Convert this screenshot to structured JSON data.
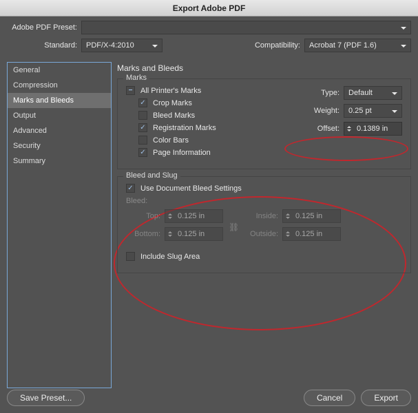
{
  "window": {
    "title": "Export Adobe PDF"
  },
  "header": {
    "preset_label": "Adobe PDF Preset:",
    "preset_value": "",
    "standard_label": "Standard:",
    "standard_value": "PDF/X-4:2010",
    "compatibility_label": "Compatibility:",
    "compatibility_value": "Acrobat 7 (PDF 1.6)"
  },
  "sidebar": {
    "items": [
      "General",
      "Compression",
      "Marks and Bleeds",
      "Output",
      "Advanced",
      "Security",
      "Summary"
    ],
    "selected_index": 2
  },
  "main": {
    "title": "Marks and Bleeds",
    "marks": {
      "group_title": "Marks",
      "all": "All Printer's Marks",
      "crop": "Crop Marks",
      "bleed_marks": "Bleed Marks",
      "registration": "Registration Marks",
      "color_bars": "Color Bars",
      "page_info": "Page Information",
      "type_label": "Type:",
      "type_value": "Default",
      "weight_label": "Weight:",
      "weight_value": "0.25 pt",
      "offset_label": "Offset:",
      "offset_value": "0.1389 in"
    },
    "bleed_slug": {
      "group_title": "Bleed and Slug",
      "use_doc_bleed": "Use Document Bleed Settings",
      "bleed_heading": "Bleed:",
      "top_label": "Top:",
      "top_value": "0.125 in",
      "bottom_label": "Bottom:",
      "bottom_value": "0.125 in",
      "inside_label": "Inside:",
      "inside_value": "0.125 in",
      "outside_label": "Outside:",
      "outside_value": "0.125 in",
      "include_slug": "Include Slug Area"
    }
  },
  "footer": {
    "save_preset": "Save Preset...",
    "cancel": "Cancel",
    "export": "Export"
  },
  "annotations": {
    "ellipses": [
      "offset-field",
      "bleed-and-slug-section"
    ],
    "color": "#c1272d"
  }
}
